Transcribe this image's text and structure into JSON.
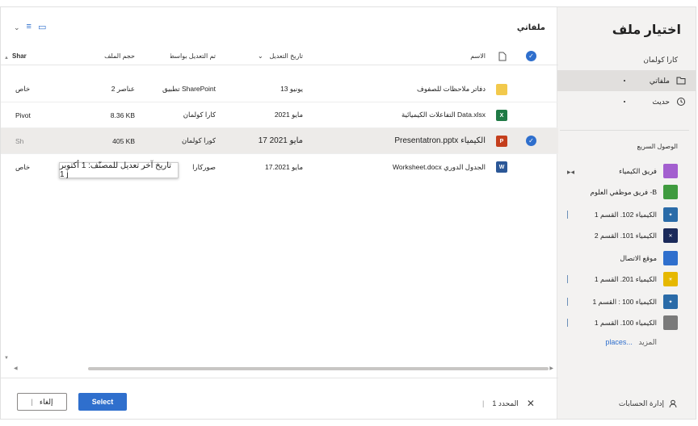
{
  "nav": {
    "title": "اختيار ملف",
    "user": "كارا كولمان",
    "items": [
      {
        "label": "ملفاتي",
        "icon": "folder-icon",
        "selected": true
      },
      {
        "label": "حديث",
        "icon": "history-icon",
        "selected": false
      }
    ],
    "quick_access_title": "الوصول السريع",
    "quick_access": [
      {
        "label": "فريق الكيمياء",
        "icon": "team-icon",
        "color": "#a35fcf",
        "badge": "ت"
      },
      {
        "label": "فريق موظفي العلوم -B",
        "icon": "team-icon",
        "color": "#3f9b3f",
        "badge": "ف"
      },
      {
        "label": "الكيمياء 102. القسم 1",
        "icon": "class-icon",
        "color": "#2a6ba8",
        "badge": ""
      },
      {
        "label": "الكيمياء 101. القسم 2",
        "icon": "dna-icon",
        "color": "#1b2a5a",
        "badge": ""
      },
      {
        "label": "موقع الاتصال",
        "icon": "site-icon",
        "color": "#2f6fcd",
        "badge": "م"
      },
      {
        "label": "الكيمياء 201. القسم 1",
        "icon": "class-icon",
        "color": "#e6b800",
        "badge": ""
      },
      {
        "label": "الكيمياء 100 : القسم 1",
        "icon": "class-icon",
        "color": "#2a6ba8",
        "badge": ""
      },
      {
        "label": "الكيمياء 100. القسم 1",
        "icon": "class-icon",
        "color": "#7a7a7a",
        "badge": "ك"
      }
    ],
    "more_label": "المزيد",
    "more_link": "places...",
    "manage_accounts": "إدارة الحسابات"
  },
  "main": {
    "title": "ملفاتي",
    "columns": {
      "name": "الاسم",
      "modified": "تاريخ التعديل",
      "modified_by": "تم التعديل بواسطة",
      "size": "حجم الملف",
      "sharing": "Shar"
    },
    "rows": [
      {
        "name": "دفاتر ملاحظات للصفوف",
        "modified": "13 يونيو",
        "modified_by": "تطبيق SharePoint",
        "size": "2 عناصر",
        "sharing": "خاص",
        "type": "folder",
        "selected": false
      },
      {
        "name": "التفاعلات  الكيميائية Data.xlsx",
        "modified": "مايو 2021",
        "modified_by": "كارا كولمان",
        "size": "8.36 KB",
        "sharing": "Pivot",
        "type": "xlsx",
        "selected": false
      },
      {
        "name": "Presentatron.pptx الكيمياء",
        "modified": "17 مايو 2021",
        "modified_by": "كورا كولمان",
        "size": "405 KB",
        "sharing": "Sh",
        "type": "pptx",
        "selected": true
      },
      {
        "name": "Worksheet.docx الجدول الدوري",
        "modified": "17.2021 مايو",
        "modified_by": "صوركارا",
        "size": "",
        "sharing": "خاص",
        "type": "docx",
        "selected": false
      }
    ],
    "tooltip": "تاريخ آخر تعديل للمصنّف: 1 أكتوبر 1 j"
  },
  "footer": {
    "selected_count": "1 المحدد",
    "select_label": "Select",
    "cancel_label": "إلغاء"
  },
  "colors": {
    "accent": "#2f6fcd",
    "excel": "#1f7a45",
    "powerpoint": "#c43e1c",
    "word": "#2b5797",
    "folder": "#f2c94c"
  }
}
